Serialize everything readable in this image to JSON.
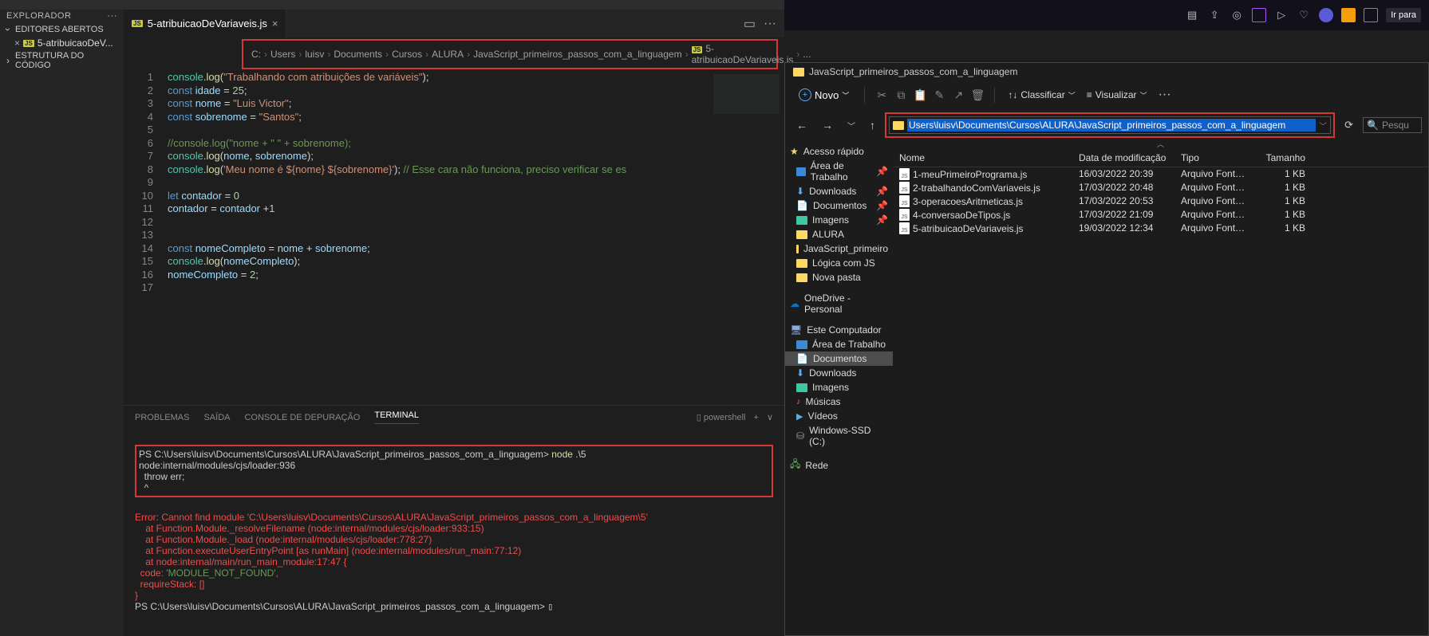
{
  "vscode": {
    "sidebar": {
      "title": "EXPLORADOR",
      "openEditors": "EDITORES ABERTOS",
      "openFile": "5-atribuicaoDeV...",
      "outline": "ESTRUTURA DO CÓDIGO"
    },
    "tab": {
      "filename": "5-atribuicaoDeVariaveis.js"
    },
    "breadcrumb": [
      "C:",
      "Users",
      "luisv",
      "Documents",
      "Cursos",
      "ALURA",
      "JavaScript_primeiros_passos_com_a_linguagem",
      "5-atribuicaoDeVariaveis.js",
      "..."
    ],
    "code": {
      "lines": [
        {
          "n": 1,
          "html": "<span class='obj'>console</span>.<span class='fn'>log</span>(<span class='str'>\"Trabalhando com atribuições de variáveis\"</span>);"
        },
        {
          "n": 2,
          "html": "<span class='kw'>const</span> <span class='var'>idade</span> = <span class='num'>25</span>;"
        },
        {
          "n": 3,
          "html": "<span class='kw'>const</span> <span class='var'>nome</span> = <span class='str'>\"Luis Victor\"</span>;"
        },
        {
          "n": 4,
          "html": "<span class='kw'>const</span> <span class='var'>sobrenome</span> = <span class='str'>\"Santos\"</span>;"
        },
        {
          "n": 5,
          "html": ""
        },
        {
          "n": 6,
          "html": "<span class='cmt'>//console.log(\"nome + \" \" + sobrenome);</span>"
        },
        {
          "n": 7,
          "html": "<span class='obj'>console</span>.<span class='fn'>log</span>(<span class='var'>nome</span>, <span class='var'>sobrenome</span>);"
        },
        {
          "n": 8,
          "html": "<span class='obj'>console</span>.<span class='fn'>log</span>(<span class='str'>'Meu nome é ${nome} ${sobrenome}'</span>); <span class='cmt'>// Esse cara não funciona, preciso verificar se es</span>"
        },
        {
          "n": 9,
          "html": ""
        },
        {
          "n": 10,
          "html": "<span class='kw'>let</span> <span class='var'>contador</span> = <span class='num'>0</span>"
        },
        {
          "n": 11,
          "html": "<span class='var'>contador</span> = <span class='var'>contador</span> +<span class='num'>1</span>"
        },
        {
          "n": 12,
          "html": ""
        },
        {
          "n": 13,
          "html": ""
        },
        {
          "n": 14,
          "html": "<span class='kw'>const</span> <span class='var'>nomeCompleto</span> = <span class='var'>nome</span> + <span class='var'>sobrenome</span>;"
        },
        {
          "n": 15,
          "html": "<span class='obj'>console</span>.<span class='fn'>log</span>(<span class='var'>nomeCompleto</span>);"
        },
        {
          "n": 16,
          "html": "<span class='var'>nomeCompleto</span> = <span class='num'>2</span>;"
        },
        {
          "n": 17,
          "html": ""
        }
      ]
    },
    "panel": {
      "tabs": {
        "problems": "PROBLEMAS",
        "output": "SAÍDA",
        "debug": "CONSOLE DE DEPURAÇÃO",
        "terminal": "TERMINAL"
      },
      "shell": "powershell",
      "terminal": {
        "block1_l1_prompt": "PS C:\\Users\\luisv\\Documents\\Cursos\\ALURA\\JavaScript_primeiros_passos_com_a_linguagem> ",
        "block1_l1_cmd": "node",
        "block1_l1_arg": " .\\5",
        "block1_l2": "node:internal/modules/cjs/loader:936",
        "block1_l3": "  throw err;",
        "block1_l4": "  ^",
        "err_l1": "Error: Cannot find module 'C:\\Users\\luisv\\Documents\\Cursos\\ALURA\\JavaScript_primeiros_passos_com_a_linguagem\\5'",
        "err_l2": "    at Function.Module._resolveFilename (node:internal/modules/cjs/loader:933:15)",
        "err_l3": "    at Function.Module._load (node:internal/modules/cjs/loader:778:27)",
        "err_l4": "    at Function.executeUserEntryPoint [as runMain] (node:internal/modules/run_main:77:12)",
        "err_l5": "    at node:internal/main/run_main_module:17:47 {",
        "err_l6a": "  code: ",
        "err_l6b": "'MODULE_NOT_FOUND'",
        "err_l6c": ",",
        "err_l7": "  requireStack: []",
        "err_l8": "}",
        "prompt2": "PS C:\\Users\\luisv\\Documents\\Cursos\\ALURA\\JavaScript_primeiros_passos_com_a_linguagem> "
      }
    }
  },
  "browser": {
    "irpara": "Ir para"
  },
  "explorer": {
    "title": "JavaScript_primeiros_passos_com_a_linguagem",
    "newbtn": "Novo",
    "sort": "Classificar",
    "view": "Visualizar",
    "path": "Users\\luisv\\Documents\\Cursos\\ALURA\\JavaScript_primeiros_passos_com_a_linguagem",
    "searchPlaceholder": "Pesqu",
    "nav": {
      "quick": "Acesso rápido",
      "desktop": "Área de Trabalho",
      "downloads": "Downloads",
      "documents": "Documentos",
      "images": "Imagens",
      "alura": "ALURA",
      "jsprim": "JavaScript_primeiro",
      "logica": "Lógica com JS",
      "novapasta": "Nova pasta",
      "onedrive": "OneDrive - Personal",
      "thispc": "Este Computador",
      "desktop2": "Área de Trabalho",
      "documents2": "Documentos",
      "downloads2": "Downloads",
      "images2": "Imagens",
      "music": "Músicas",
      "videos": "Vídeos",
      "drive": "Windows-SSD (C:)",
      "network": "Rede"
    },
    "headers": {
      "name": "Nome",
      "date": "Data de modificação",
      "type": "Tipo",
      "size": "Tamanho"
    },
    "files": [
      {
        "name": "1-meuPrimeiroPrograma.js",
        "date": "16/03/2022 20:39",
        "type": "Arquivo Fonte Jav...",
        "size": "1 KB"
      },
      {
        "name": "2-trabalhandoComVariaveis.js",
        "date": "17/03/2022 20:48",
        "type": "Arquivo Fonte Jav...",
        "size": "1 KB"
      },
      {
        "name": "3-operacoesAritmeticas.js",
        "date": "17/03/2022 20:53",
        "type": "Arquivo Fonte Jav...",
        "size": "1 KB"
      },
      {
        "name": "4-conversaoDeTipos.js",
        "date": "17/03/2022 21:09",
        "type": "Arquivo Fonte Jav...",
        "size": "1 KB"
      },
      {
        "name": "5-atribuicaoDeVariaveis.js",
        "date": "19/03/2022 12:34",
        "type": "Arquivo Fonte Jav...",
        "size": "1 KB"
      }
    ]
  }
}
